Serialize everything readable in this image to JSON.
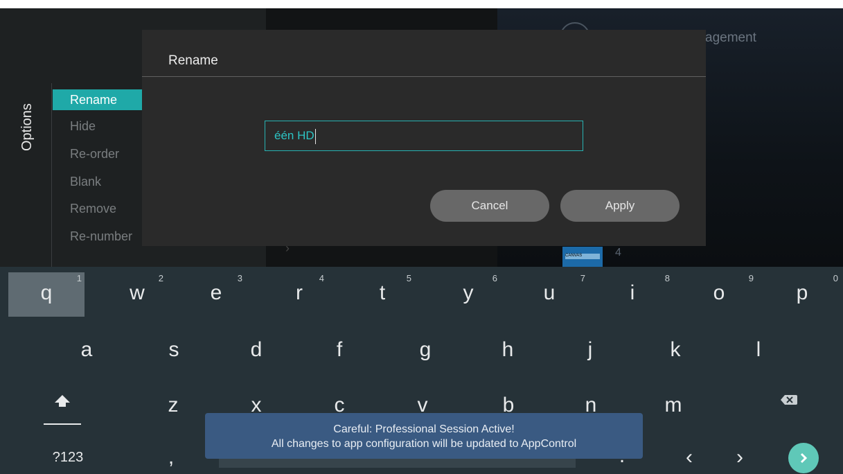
{
  "background": {
    "partial_title": "agement",
    "channel_number": "4",
    "thumb_label": "CANVAS"
  },
  "options": {
    "title": "Options",
    "items": [
      "Rename",
      "Hide",
      "Re-order",
      "Blank",
      "Remove",
      "Re-number"
    ],
    "active_index": 0
  },
  "dialog": {
    "title": "Rename",
    "input_value": "één HD",
    "cancel_label": "Cancel",
    "apply_label": "Apply"
  },
  "keyboard": {
    "row1": [
      {
        "key": "q",
        "hint": "1"
      },
      {
        "key": "w",
        "hint": "2"
      },
      {
        "key": "e",
        "hint": "3"
      },
      {
        "key": "r",
        "hint": "4"
      },
      {
        "key": "t",
        "hint": "5"
      },
      {
        "key": "y",
        "hint": "6"
      },
      {
        "key": "u",
        "hint": "7"
      },
      {
        "key": "i",
        "hint": "8"
      },
      {
        "key": "o",
        "hint": "9"
      },
      {
        "key": "p",
        "hint": "0"
      }
    ],
    "row2": [
      "a",
      "s",
      "d",
      "f",
      "g",
      "h",
      "j",
      "k",
      "l"
    ],
    "row3": [
      "z",
      "x",
      "c",
      "v",
      "b",
      "n",
      "m"
    ],
    "symbols_label": "?123",
    "comma": ",",
    "period": ".",
    "left_arrow": "‹",
    "right_arrow": "›",
    "shift_icon": "shift-arrow-icon",
    "backspace_icon": "backspace-icon",
    "enter_icon": "go-arrow-icon",
    "accent_color": "#5fc8b8"
  },
  "toast": {
    "line1": "Careful: Professional Session Active!",
    "line2": "All changes to app configuration will be updated to AppControl"
  }
}
